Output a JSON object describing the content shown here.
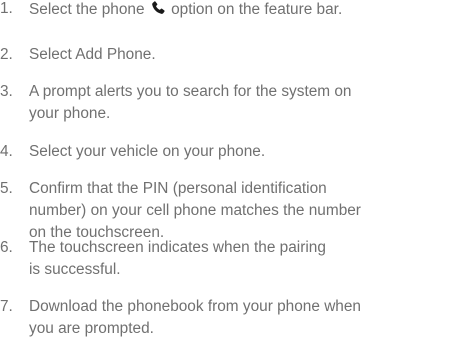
{
  "instructions": {
    "steps": [
      {
        "number": "1.",
        "lines": [
          "Select the phone",
          "option on the feature bar."
        ]
      },
      {
        "number": "2.",
        "lines": [
          "Select Add Phone."
        ]
      },
      {
        "number": "3.",
        "lines": [
          "A prompt alerts you to search for the system on",
          "your phone."
        ]
      },
      {
        "number": "4.",
        "lines": [
          "Select your vehicle on your phone."
        ]
      },
      {
        "number": "5.",
        "lines": [
          "Confirm that the PIN (personal identification",
          "number) on your cell phone matches the number",
          "on the touchscreen."
        ]
      },
      {
        "number": "6.",
        "lines": [
          "The touchscreen indicates when the pairing",
          "is successful."
        ]
      },
      {
        "number": "7.",
        "lines": [
          "Download the phonebook from your phone when",
          "you are prompted."
        ]
      }
    ],
    "icon": "phone-icon",
    "text_color": "#707070",
    "icon_color": "#1a1a1a"
  }
}
